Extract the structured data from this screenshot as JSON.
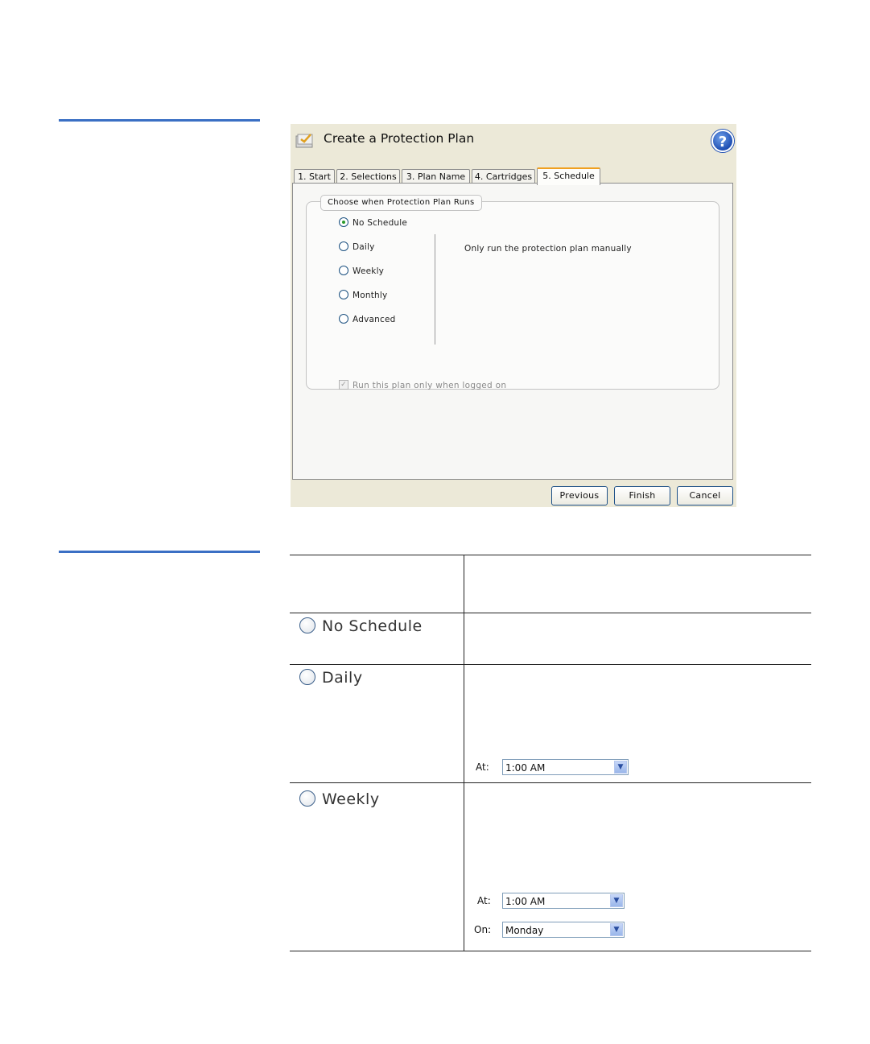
{
  "dialog": {
    "title": "Create a Protection Plan",
    "help_label": "?",
    "tabs": [
      {
        "label": "1. Start",
        "active": false
      },
      {
        "label": "2. Selections",
        "active": false
      },
      {
        "label": "3. Plan Name",
        "active": false
      },
      {
        "label": "4. Cartridges",
        "active": false
      },
      {
        "label": "5. Schedule",
        "active": true
      }
    ],
    "group_title": "Choose when Protection Plan Runs",
    "options": [
      {
        "label": "No Schedule",
        "selected": true
      },
      {
        "label": "Daily",
        "selected": false
      },
      {
        "label": "Weekly",
        "selected": false
      },
      {
        "label": "Monthly",
        "selected": false
      },
      {
        "label": "Advanced",
        "selected": false
      }
    ],
    "description": "Only run the protection plan manually",
    "logon_checkbox": {
      "label": "Run this plan only when logged on",
      "checked": true,
      "enabled": false
    },
    "buttons": {
      "previous": "Previous",
      "finish": "Finish",
      "cancel": "Cancel"
    }
  },
  "table": {
    "rows": [
      {
        "option": "No Schedule"
      },
      {
        "option": "Daily",
        "at_label": "At:",
        "at_value": "1:00 AM"
      },
      {
        "option": "Weekly",
        "at_label": "At:",
        "at_value": "1:00 AM",
        "on_label": "On:",
        "on_value": "Monday"
      }
    ]
  },
  "colors": {
    "accent_rule": "#3a6fc4",
    "active_tab": "#f0a020"
  }
}
